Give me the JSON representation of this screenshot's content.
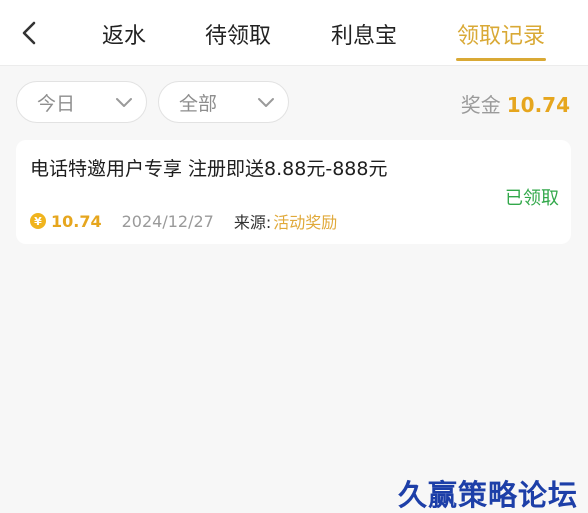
{
  "header": {
    "tabs": [
      {
        "label": "返水",
        "active": false
      },
      {
        "label": "待领取",
        "active": false
      },
      {
        "label": "利息宝",
        "active": false
      },
      {
        "label": "领取记录",
        "active": true
      }
    ],
    "back_icon": "chevron-left-icon"
  },
  "filters": {
    "date_range": {
      "value": "今日",
      "icon": "chevron-down-icon"
    },
    "type": {
      "value": "全部",
      "icon": "chevron-down-icon"
    }
  },
  "prize": {
    "label": "奖金",
    "value": "10.74"
  },
  "records": [
    {
      "title": "电话特邀用户专享 注册即送8.88元-888元",
      "status": "已领取",
      "coin_symbol": "¥",
      "amount": "10.74",
      "date": "2024/12/27",
      "source_label": "来源:",
      "source_value": "活动奖励"
    }
  ],
  "watermark": "久赢策略论坛",
  "colors": {
    "accent": "#d9a935",
    "amount": "#e6a61e",
    "status_green": "#32a84a",
    "watermark": "#1d3fa8",
    "background": "#f7f7f7"
  }
}
